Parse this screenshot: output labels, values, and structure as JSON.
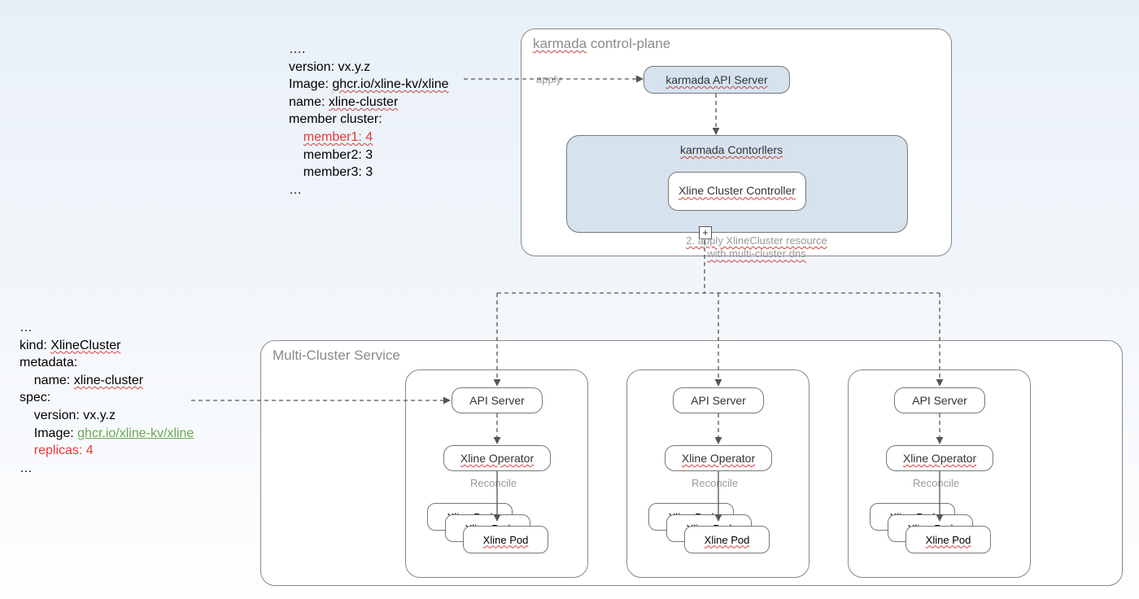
{
  "yaml1": {
    "l0": "….",
    "l1": "version: vx.y.z",
    "l2_label": "Image: ",
    "l2_value": "ghcr.io/xline-kv/xline",
    "l3_label": "name: ",
    "l3_value": "xline-cluster",
    "l4": "member cluster:",
    "l5": "member1: 4",
    "l6": "member2: 3",
    "l7": "member3: 3",
    "l8": "…"
  },
  "yaml2": {
    "l0": "…",
    "l1_label": "kind: ",
    "l1_value": "XlineCluster",
    "l2": "metadata:",
    "l3_label": "    name: ",
    "l3_value": "xline-cluster",
    "l4": "spec:",
    "l5": "    version: vx.y.z",
    "l6_label": "    Image: ",
    "l6_value": "ghcr.io/xline-kv/xline",
    "l7": "    replicas: 4",
    "l8": "…"
  },
  "karmada_box": {
    "title_a": "karmada",
    "title_b": " control-plane",
    "apply_label": "apply",
    "api_server": "karmada API Server",
    "controllers": "karmada Contorllers",
    "xline_controller": "Xline Cluster Controller",
    "step2": "2. apply XlineCluster resource\nwith multi-cluster dns",
    "plus": "+"
  },
  "multi": {
    "title": "Multi-Cluster Service",
    "api_server": "API Server",
    "operator": "Xline Operator",
    "reconcile": "Reconcile",
    "pod": "Xline Pod"
  }
}
